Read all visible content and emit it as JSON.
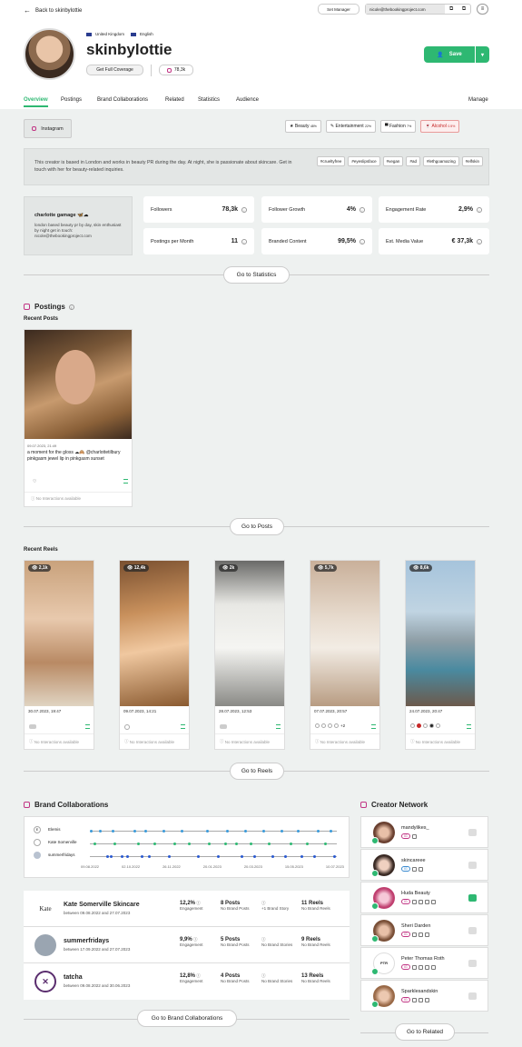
{
  "header": {
    "back_label": "Back to skinbylottie",
    "set_manager": "Set Manager",
    "email": "nicole@thebookingproject.com"
  },
  "profile": {
    "country": "United Kingdom",
    "language": "English",
    "name": "skinbylottie",
    "coverage_button": "Get Full Coverage",
    "followers_badge": "78,3k",
    "save_button": "Save"
  },
  "tabs": [
    "Overview",
    "Postings",
    "Brand Collaborations",
    "Related",
    "Statistics",
    "Audience"
  ],
  "manage_label": "Manage",
  "platform_tab": "Instagram",
  "categories": [
    {
      "label": "Beauty",
      "pct": "48%"
    },
    {
      "label": "Entertainment",
      "pct": "22%"
    },
    {
      "label": "Fashion",
      "pct": "7%"
    },
    {
      "label": "Alcohol",
      "pct": "0.5%"
    }
  ],
  "bio": "This creator is based in London and works in beauty PR during the day. At night, she is passionate about skincare. Get in touch with her for beauty-related inquiries.",
  "hashtags": [
    "#crueltyfree",
    "#eyeslipsface",
    "#vegan",
    "#ad",
    "#lethgoamazing",
    "#elfskin"
  ],
  "account": {
    "name": "charlotte gamage 🦋☁",
    "desc": "london based beauty pr by day, skin enthusiast by night get in touch: nicole@thebookingproject.com"
  },
  "metrics": [
    {
      "label": "Followers",
      "value": "78,3k"
    },
    {
      "label": "Follower Growth",
      "value": "4%"
    },
    {
      "label": "Engagement Rate",
      "value": "2,9%"
    },
    {
      "label": "Postings per Month",
      "value": "11"
    },
    {
      "label": "Branded Content",
      "value": "99,5%"
    },
    {
      "label": "Est. Media Value",
      "value": "€ 37,3k"
    }
  ],
  "go_stats": "Go to Statistics",
  "postings": {
    "title": "Postings",
    "recent_posts": "Recent Posts",
    "post_date": "09.07.2023, 21:49",
    "post_caption": "a moment for the gloss ☁🙈 @charlottetilbury pinkgasm jewel lip in pinkgasm sunset",
    "no_interactions": "No Interactions available",
    "go_posts": "Go to Posts"
  },
  "reels": {
    "title": "Recent Reels",
    "items": [
      {
        "views": "2,1k",
        "date": "30.07.2023, 19:47"
      },
      {
        "views": "12,4k",
        "date": "09.07.2023, 14:21"
      },
      {
        "views": "2k",
        "date": "28.07.2023, 12:53"
      },
      {
        "views": "5,7k",
        "date": "07.07.2023, 20:57"
      },
      {
        "views": "8,6k",
        "date": "24.07.2023, 20:47"
      }
    ],
    "extra": "+2",
    "no_interactions": "No Interactions available",
    "go_reels": "Go to Reels"
  },
  "brands": {
    "title": "Brand Collaborations",
    "timeline_names": [
      "Elemis",
      "Kate Somerville",
      "summerfridays"
    ],
    "timeline_dates": [
      "09.08.2022",
      "02.10.2022",
      "26.11.2022",
      "20.01.2023",
      "20.03.2023",
      "15.05.2023",
      "10.07.2023"
    ],
    "rows": [
      {
        "logo": "Kate",
        "name": "Kate Somerville Skincare",
        "dates": "between 09.08.2022 and 27.07.2023",
        "eng": "12,2%",
        "posts": "8 Posts",
        "posts_sub": "No Brand Posts",
        "story": "+1 Brand Story",
        "reels": "11 Reels",
        "reels_sub": "No Brand Reels"
      },
      {
        "logo": "",
        "name": "summerfridays",
        "dates": "between 17.09.2022 and 27.07.2023",
        "eng": "9,9%",
        "posts": "5 Posts",
        "posts_sub": "No Brand Posts",
        "story": "No Brand Stories",
        "reels": "9 Reels",
        "reels_sub": "No Brand Reels"
      },
      {
        "logo": "",
        "name": "tatcha",
        "dates": "between 09.08.2022 and 30.06.2023",
        "eng": "12,8%",
        "posts": "4 Posts",
        "posts_sub": "No Brand Posts",
        "story": "No Brand Stories",
        "reels": "13 Reels",
        "reels_sub": "No Brand Reels"
      }
    ],
    "eng_label": "Engagement",
    "go_brands": "Go to Brand Collaborations"
  },
  "network": {
    "title": "Creator Network",
    "items": [
      "mandylikes_",
      "skincareee",
      "Huda Beauty",
      "Sheri Darden",
      "Peter Thomas Roth",
      "Sparklesandskin"
    ],
    "go_related": "Go to Related"
  }
}
